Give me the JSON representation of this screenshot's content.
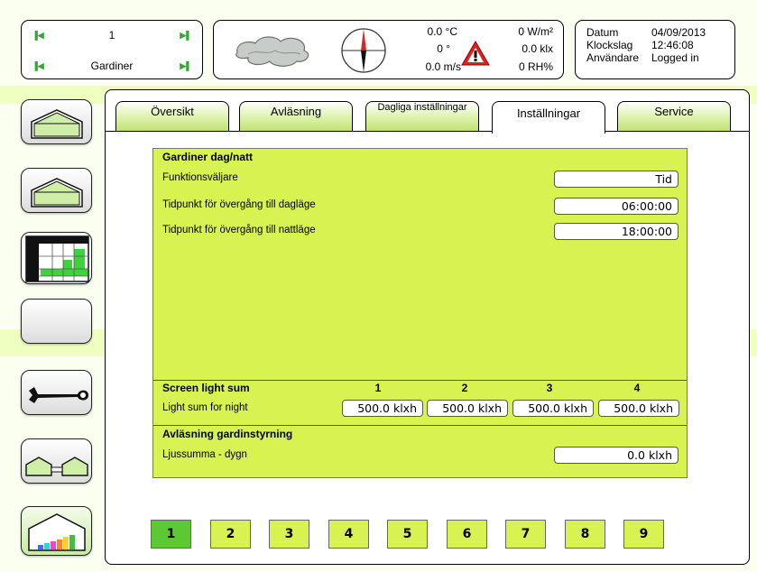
{
  "header": {
    "nav": {
      "top_value": "1",
      "bottom_value": "Gardiner"
    },
    "weather": {
      "temperature": "0.0 °C",
      "radiation": "0 W/m²",
      "wind_direction": "0 °",
      "light": "0.0 klx",
      "wind_speed": "0.0 m/s",
      "humidity": "0 RH%"
    },
    "info": {
      "date_label": "Datum",
      "date_value": "04/09/2013",
      "time_label": "Klockslag",
      "time_value": "12:46:08",
      "user_label": "Användare",
      "user_value": "Logged in"
    }
  },
  "sidebar": {
    "items": [
      {
        "icon": "greenhouse-icon"
      },
      {
        "icon": "greenhouse-icon"
      },
      {
        "icon": "table-chart-icon"
      },
      {
        "icon": "blank-icon"
      },
      {
        "icon": "wrench-icon"
      },
      {
        "icon": "connected-greenhouses-icon"
      },
      {
        "icon": "greenhouse-bar-chart-icon"
      }
    ]
  },
  "tabs": [
    {
      "label": "Översikt"
    },
    {
      "label": "Avläsning"
    },
    {
      "label": "Dagliga inställningar"
    },
    {
      "label": "Inställningar"
    },
    {
      "label": "Service"
    }
  ],
  "section_curtains": {
    "title": "Gardiner dag/natt",
    "function_label": "Funktionsväljare",
    "function_value": "Tid",
    "day_label": "Tidpunkt för övergång till dagläge",
    "day_value": "06:00:00",
    "night_label": "Tidpunkt för övergång till nattläge",
    "night_value": "18:00:00"
  },
  "section_light": {
    "title": "Screen light sum",
    "columns": [
      "1",
      "2",
      "3",
      "4"
    ],
    "row_label": "Light sum for night",
    "values": [
      "500.0 klxh",
      "500.0 klxh",
      "500.0 klxh",
      "500.0 klxh"
    ]
  },
  "section_reading": {
    "title": "Avläsning gardinstyrning",
    "label": "Ljussumma - dygn",
    "value": "0.0 klxh"
  },
  "pages": [
    "1",
    "2",
    "3",
    "4",
    "5",
    "6",
    "7",
    "8",
    "9"
  ],
  "colors": {
    "panel_green": "#d7f251",
    "active_page": "#5cc832",
    "warning_red": "#e02020"
  }
}
